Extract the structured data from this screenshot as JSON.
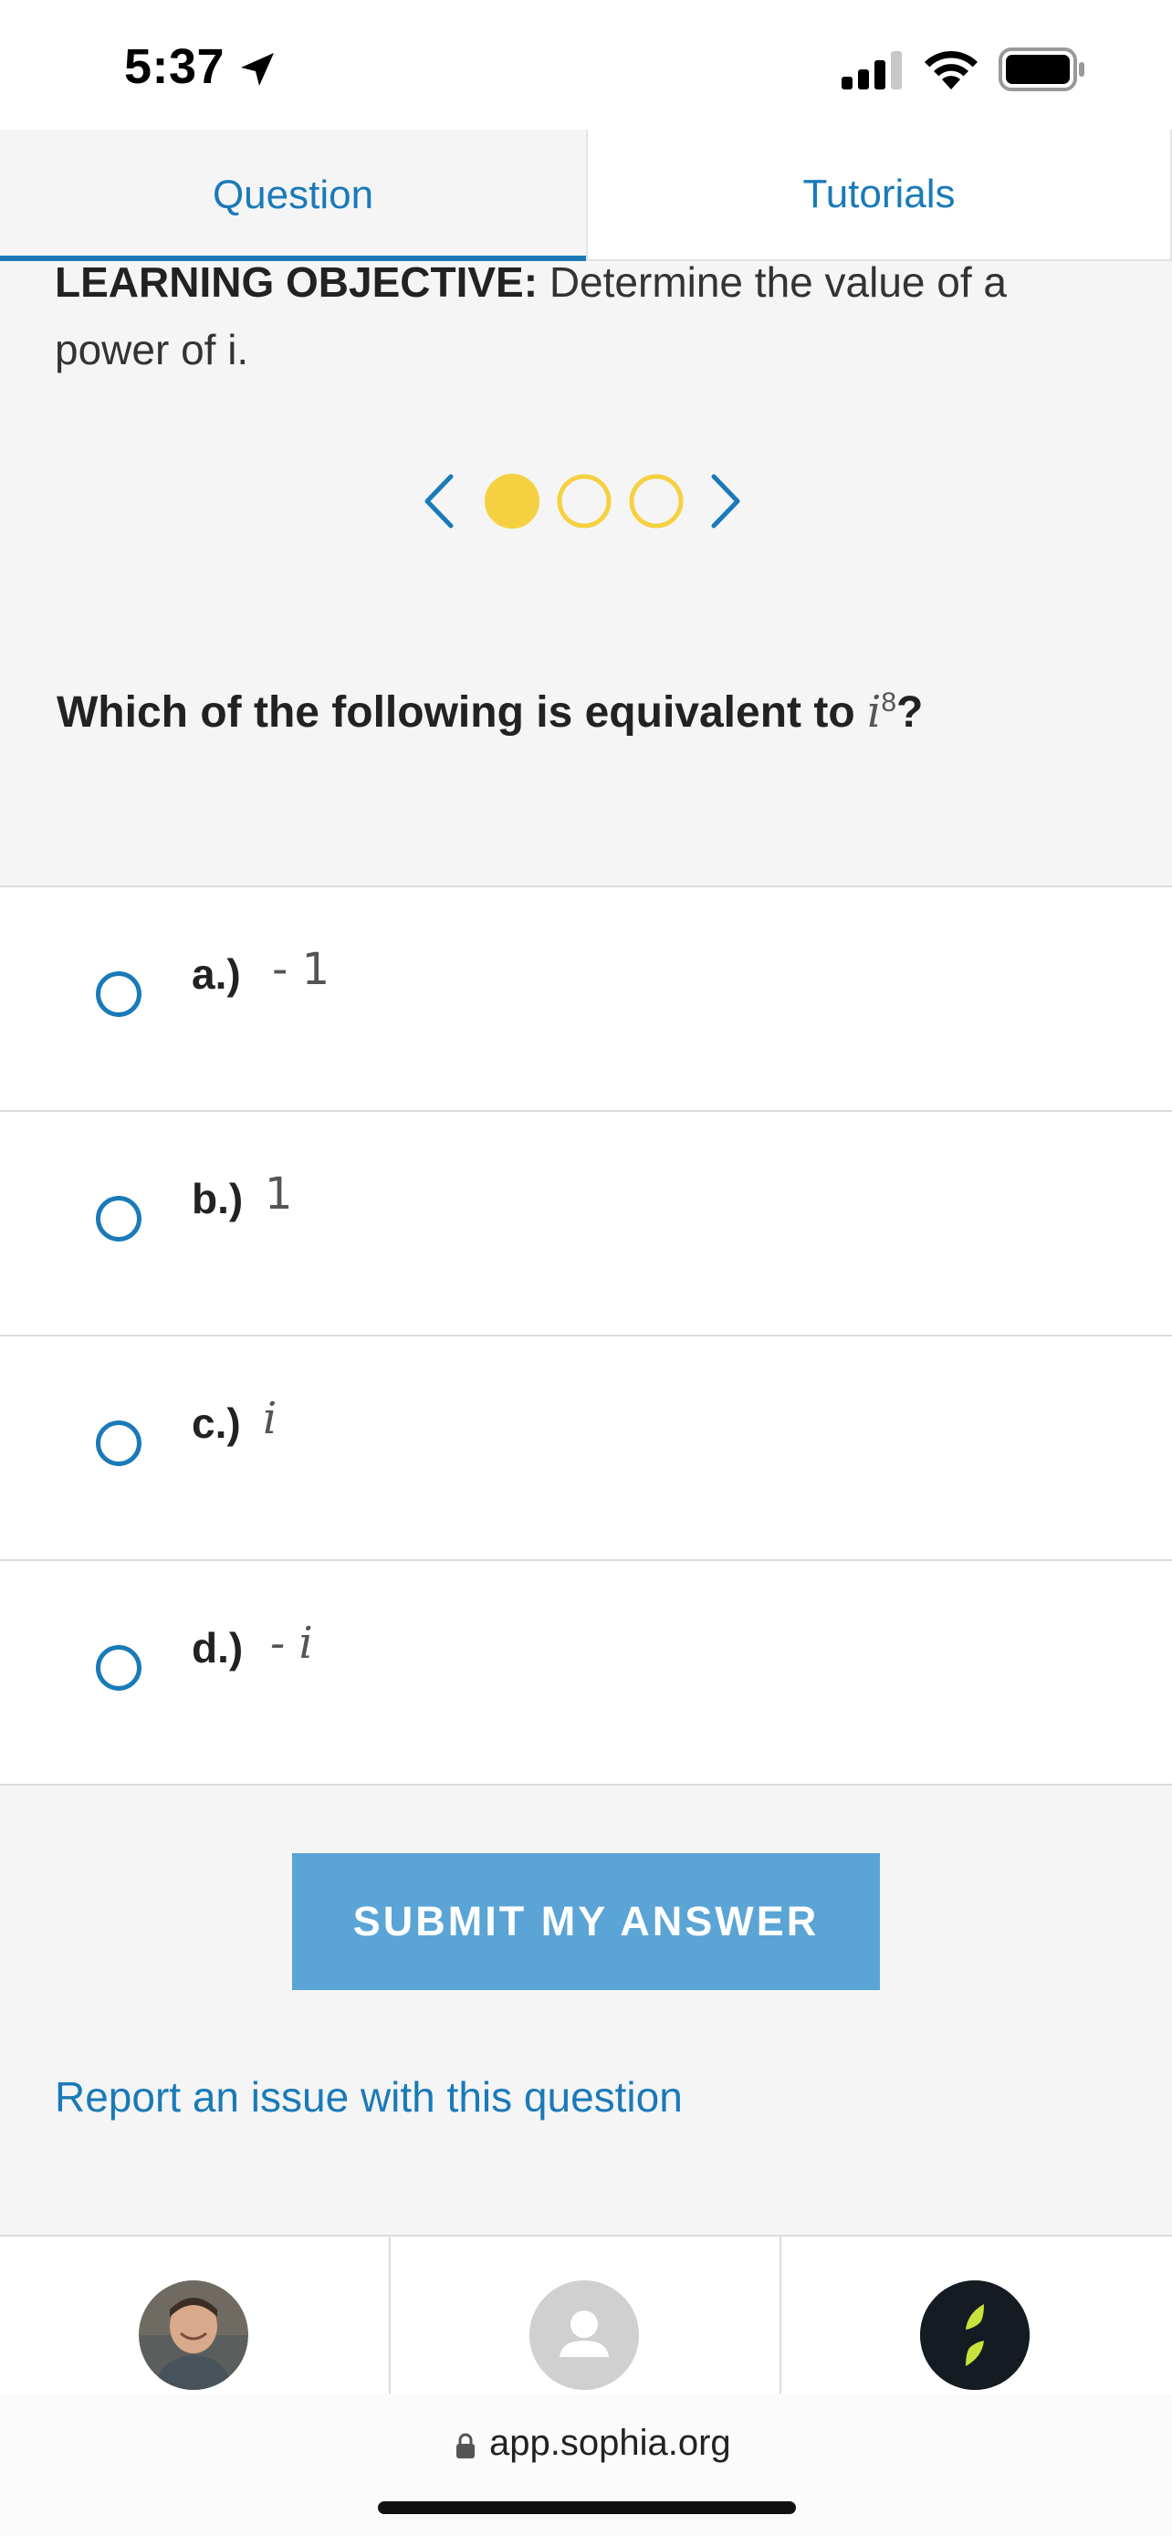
{
  "status_bar": {
    "time": "5:37"
  },
  "tabs": [
    {
      "label": "Question",
      "active": true
    },
    {
      "label": "Tutorials",
      "active": false
    }
  ],
  "objective": {
    "label": "LEARNING OBJECTIVE:",
    "text": "Determine the value of a power of i."
  },
  "pager": {
    "total": 3,
    "current": 1,
    "fill_color": "#f5d142"
  },
  "question": {
    "prefix": "Which of the following is equivalent to",
    "base": "i",
    "exponent": "8",
    "suffix": "?"
  },
  "options": [
    {
      "letter": "a.)",
      "value": "- 1",
      "italic": false
    },
    {
      "letter": "b.)",
      "value": "1",
      "italic": false
    },
    {
      "letter": "c.)",
      "value": "i",
      "italic": true
    },
    {
      "letter": "d.)",
      "value": "- i",
      "italic": true
    }
  ],
  "submit": {
    "label": "SUBMIT MY ANSWER"
  },
  "report": {
    "label": "Report an issue with this question"
  },
  "browser": {
    "url": "app.sophia.org"
  },
  "colors": {
    "accent": "#1a7ab8",
    "submit_bg": "#5aa4d6",
    "pager_yellow": "#f5d142"
  }
}
